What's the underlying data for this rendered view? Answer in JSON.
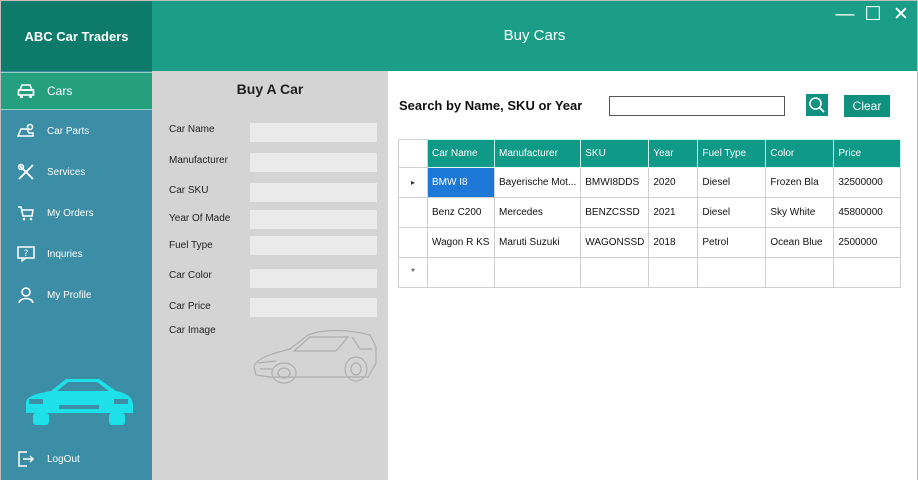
{
  "app": {
    "brand": "ABC Car Traders",
    "header_title": "Buy Cars",
    "window_controls": {
      "minimize": "—",
      "maximize": "☐",
      "close": "✕"
    }
  },
  "sidebar": {
    "items": [
      {
        "label": "Cars",
        "icon": "car-icon",
        "active": true
      },
      {
        "label": "Car Parts",
        "icon": "car-parts-icon",
        "active": false
      },
      {
        "label": "Services",
        "icon": "tools-icon",
        "active": false
      },
      {
        "label": "My Orders",
        "icon": "cart-icon",
        "active": false
      },
      {
        "label": "Inquries",
        "icon": "question-icon",
        "active": false
      },
      {
        "label": "My Profile",
        "icon": "user-icon",
        "active": false
      }
    ],
    "logout_label": "LogOut"
  },
  "form": {
    "title": "Buy A Car",
    "labels": {
      "car_name": "Car Name",
      "manufacturer": "Manufacturer",
      "car_sku": "Car SKU",
      "year_of_made": "Year Of Made",
      "fuel_type": "Fuel Type",
      "car_color": "Car Color",
      "car_price": "Car Price",
      "car_image": "Car Image"
    }
  },
  "search": {
    "label": "Search by Name, SKU or Year",
    "value": "",
    "clear_label": "Clear"
  },
  "table": {
    "columns": [
      "Car Name",
      "Manufacturer",
      "SKU",
      "Year",
      "Fuel Type",
      "Color",
      "Price"
    ],
    "rows": [
      [
        "BMW I8",
        "Bayerische Mot...",
        "BMWI8DDS",
        "2020",
        "Diesel",
        "Frozen Bla",
        "32500000"
      ],
      [
        "Benz C200",
        "Mercedes",
        "BENZCSSD",
        "2021",
        "Diesel",
        "Sky White",
        "45800000"
      ],
      [
        "Wagon R KS",
        "Maruti Suzuki",
        "WAGONSSD",
        "2018",
        "Petrol",
        "Ocean Blue",
        "2500000"
      ]
    ],
    "current_row_marker": "▸",
    "new_row_marker": "*"
  },
  "colors": {
    "sidebar": "#3b8ea5",
    "brand_bg": "#0d7a6a",
    "header": "#1b9e87",
    "accent": "#10907e",
    "selection": "#1e78d7"
  }
}
